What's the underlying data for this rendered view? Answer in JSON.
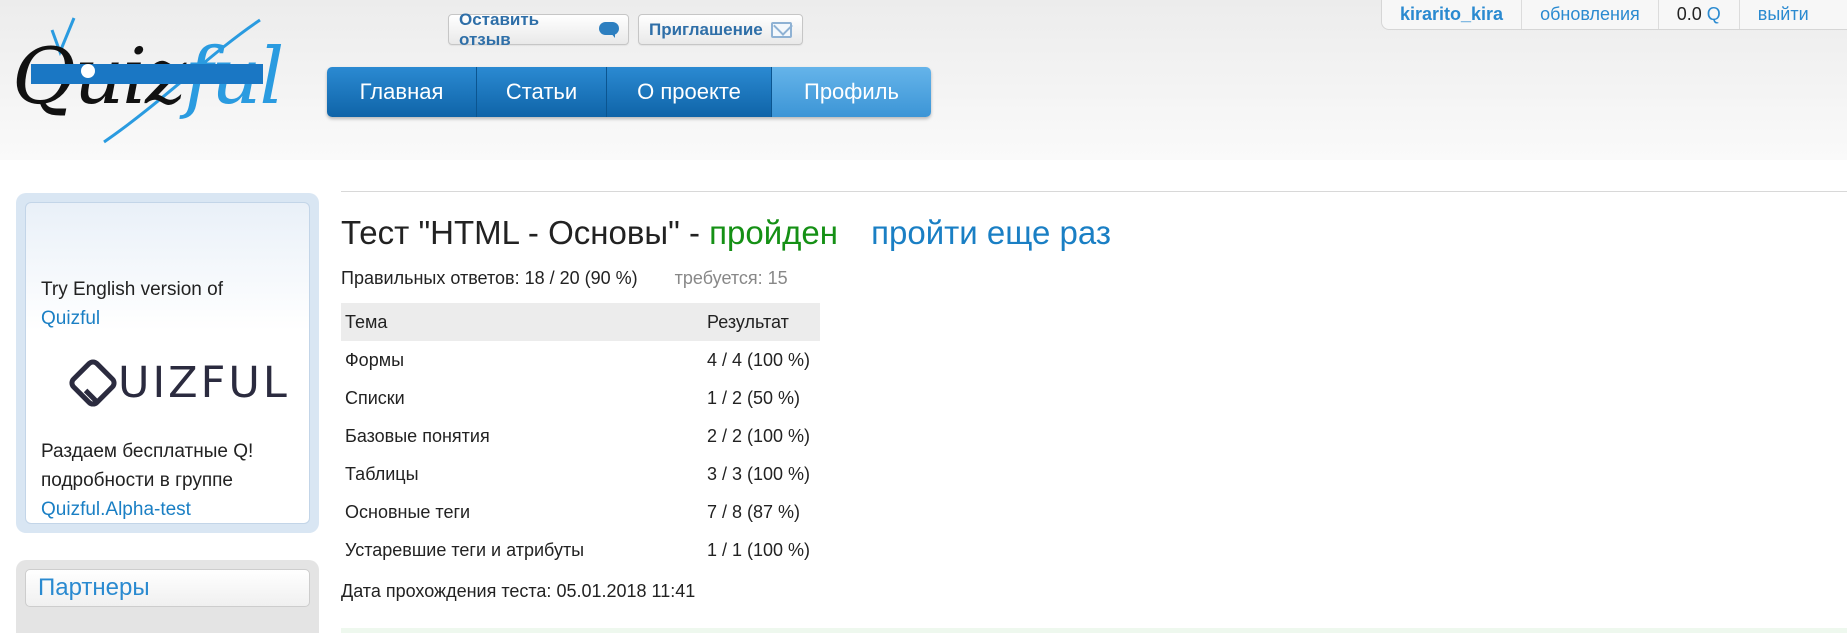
{
  "header": {
    "logo": {
      "text_main": "Quiz",
      "text_accent": "ful"
    },
    "top_buttons": {
      "review_label": "Оставить отзыв",
      "invite_label": "Приглашение"
    },
    "nav": [
      {
        "label": "Главная"
      },
      {
        "label": "Статьи"
      },
      {
        "label": "О проекте"
      },
      {
        "label": "Профиль",
        "active": true
      }
    ],
    "userbar": {
      "username": "kirarito_kira",
      "updates": "обновления",
      "balance": "0.0",
      "currency": "Q",
      "logout": "выйти"
    }
  },
  "sidebar": {
    "promo": {
      "try_text": "Try English version of",
      "try_link": "Quizful",
      "logo_text": "UIZFUL",
      "free_line1": "Раздаем бесплатные Q!",
      "free_line2": "подробности в группе",
      "free_link": "Quizful.Alpha-test"
    },
    "partners_title": "Партнеры"
  },
  "main": {
    "title_prefix": "Тест \"HTML - Основы\" -",
    "status": "пройден",
    "retry_link": "пройти еще раз",
    "correct_answers": "Правильных ответов: 18 / 20 (90 %)",
    "required": "требуется: 15",
    "table": {
      "headers": [
        "Тема",
        "Результат"
      ],
      "rows": [
        {
          "topic": "Формы",
          "result": "4 / 4 (100 %)"
        },
        {
          "topic": "Списки",
          "result": "1 / 2 (50 %)"
        },
        {
          "topic": "Базовые понятия",
          "result": "2 / 2 (100 %)"
        },
        {
          "topic": "Таблицы",
          "result": "3 / 3 (100 %)"
        },
        {
          "topic": "Основные теги",
          "result": "7 / 8 (87 %)"
        },
        {
          "topic": "Устаревшие теги и атрибуты",
          "result": "1 / 1 (100 %)"
        }
      ]
    },
    "test_date": "Дата прохождения теста: 05.01.2018 11:41"
  },
  "colors": {
    "accent_blue": "#1a7fc4",
    "nav_blue": "#0f64a8",
    "passed_green": "#159015"
  },
  "icons": {
    "review_button": "chat-bubble-icon",
    "invite_button": "envelope-icon"
  }
}
